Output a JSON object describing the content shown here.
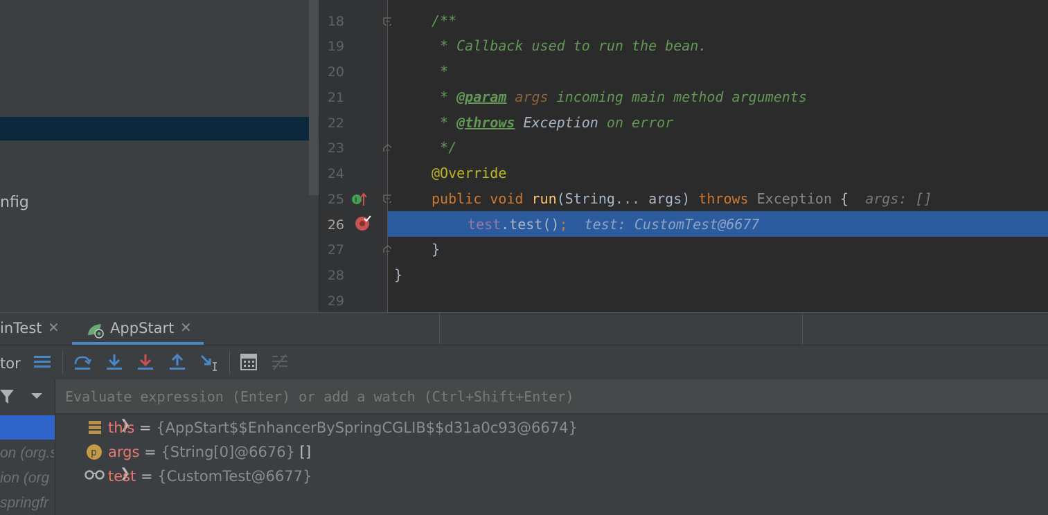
{
  "project_panel": {
    "item_label": "nfig"
  },
  "editor": {
    "lines": [
      {
        "n": "18",
        "text": "/**"
      },
      {
        "n": "19",
        "text": " * Callback used to run the bean."
      },
      {
        "n": "20",
        "text": " *"
      },
      {
        "n": "21",
        "tag": "@param",
        "param": "args",
        "rest": "incoming main method arguments"
      },
      {
        "n": "22",
        "tag": "@throws",
        "type": "Exception",
        "rest": "on error"
      },
      {
        "n": "23",
        "text": " */"
      },
      {
        "n": "24",
        "annotation": "@Override"
      },
      {
        "n": "25",
        "kw1": "public",
        "kw2": "void",
        "fn": "run",
        "params": "(String... args) ",
        "kw3": "throws",
        "ex": "Exception",
        "brace": " {",
        "hint": "args: []"
      },
      {
        "n": "26",
        "field": "test",
        "call": ".test()",
        "semi": ";",
        "hint": "test: CustomTest@6677"
      },
      {
        "n": "27",
        "text": "}"
      },
      {
        "n": "28",
        "text": "}"
      },
      {
        "n": "29",
        "text": ""
      }
    ]
  },
  "debug": {
    "tabs": [
      {
        "label": "inTest",
        "close": "✕"
      },
      {
        "label": "AppStart",
        "close": "✕"
      }
    ],
    "toolbar_left_label": "tor",
    "evaluate_placeholder": "Evaluate expression (Enter) or add a watch (Ctrl+Shift+Enter)",
    "frames": [
      "on (org.s",
      "ion (org",
      "springfr"
    ],
    "variables": [
      {
        "name": "this",
        "eq": "=",
        "value": "{AppStart$$EnhancerBySpringCGLIB$$d31a0c93@6674}",
        "icon": "field-icon",
        "expandable": true
      },
      {
        "name": "args",
        "eq": "=",
        "value": "{String[0]@6676}",
        "extra": "[]",
        "icon": "parameter-icon",
        "icon_letter": "p",
        "expandable": false
      },
      {
        "name": "test",
        "eq": "=",
        "value": "{CustomTest@6677}",
        "icon": "watch-icon",
        "expandable": true
      }
    ],
    "colors": {
      "accent": "#4a88c7",
      "exec_line": "#2d5c9e",
      "breakpoint": "#c75450"
    }
  }
}
